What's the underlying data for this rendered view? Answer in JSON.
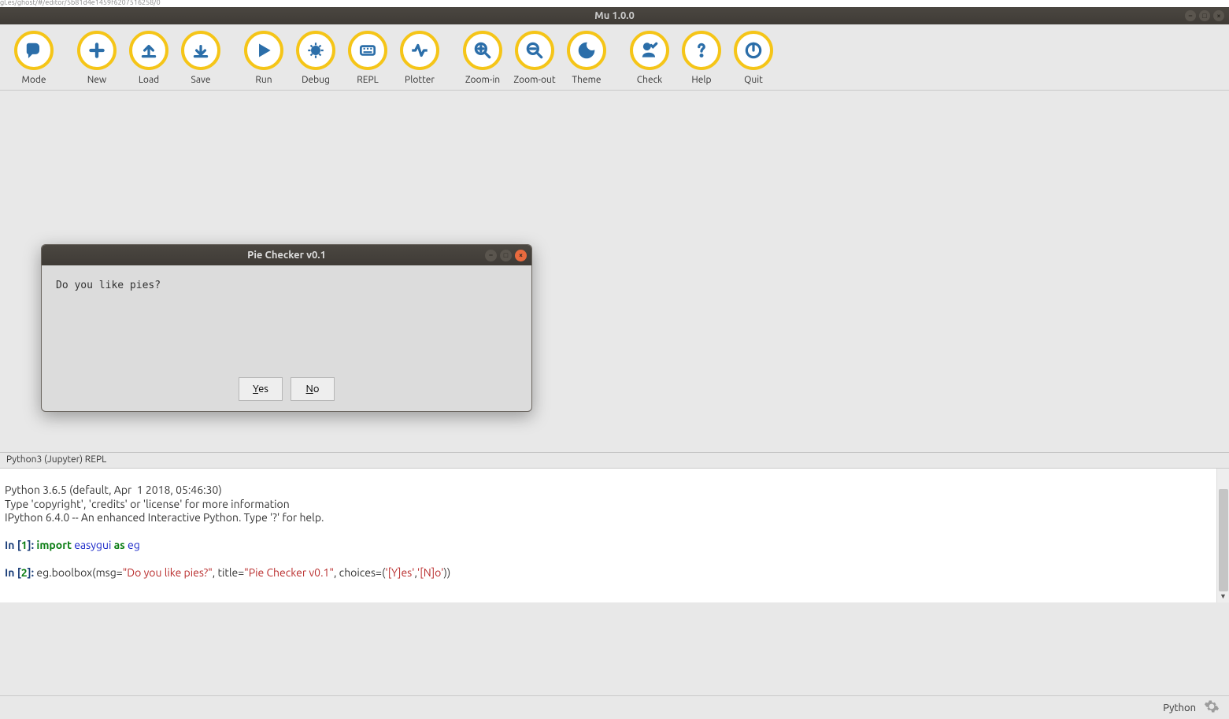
{
  "os_top": {
    "address": "gl.es/ghost/#/editor/5b81d4e1459f6207516258/0"
  },
  "window": {
    "title": "Mu 1.0.0"
  },
  "toolbar": {
    "groups": [
      [
        {
          "key": "mode",
          "label": "Mode"
        }
      ],
      [
        {
          "key": "new",
          "label": "New"
        },
        {
          "key": "load",
          "label": "Load"
        },
        {
          "key": "save",
          "label": "Save"
        }
      ],
      [
        {
          "key": "run",
          "label": "Run"
        },
        {
          "key": "debug",
          "label": "Debug"
        },
        {
          "key": "repl",
          "label": "REPL"
        },
        {
          "key": "plotter",
          "label": "Plotter"
        }
      ],
      [
        {
          "key": "zoomin",
          "label": "Zoom-in"
        },
        {
          "key": "zoomout",
          "label": "Zoom-out"
        },
        {
          "key": "theme",
          "label": "Theme"
        }
      ],
      [
        {
          "key": "check",
          "label": "Check"
        },
        {
          "key": "help",
          "label": "Help"
        },
        {
          "key": "quit",
          "label": "Quit"
        }
      ]
    ]
  },
  "dialog": {
    "title": "Pie Checker v0.1",
    "message": "Do you like pies?",
    "buttons": {
      "yes": "Yes",
      "no": "No"
    }
  },
  "repl_panel": {
    "label": "Python3 (Jupyter) REPL",
    "lines": {
      "l0": "Python 3.6.5 (default, Apr  1 2018, 05:46:30)",
      "l1": "Type 'copyright', 'credits' or 'license' for more information",
      "l2": "IPython 6.4.0 -- An enhanced Interactive Python. Type '?' for help.",
      "in1_label": "In [",
      "in1_num": "1",
      "in1_close": "]: ",
      "in1_import": "import",
      "in1_mod": " easygui ",
      "in1_as": "as",
      "in1_alias": " eg",
      "in2_label": "In [",
      "in2_num": "2",
      "in2_close": "]: ",
      "in2_code_a": "eg.boolbox(msg=",
      "in2_str1": "\"Do you like pies?\"",
      "in2_code_b": ", title=",
      "in2_str2": "\"Pie Checker v0.1\"",
      "in2_code_c": ", choices=(",
      "in2_str3": "'[Y]es'",
      "in2_code_d": ",",
      "in2_str4": "'[N]o'",
      "in2_code_e": "))"
    }
  },
  "status": {
    "mode": "Python"
  }
}
